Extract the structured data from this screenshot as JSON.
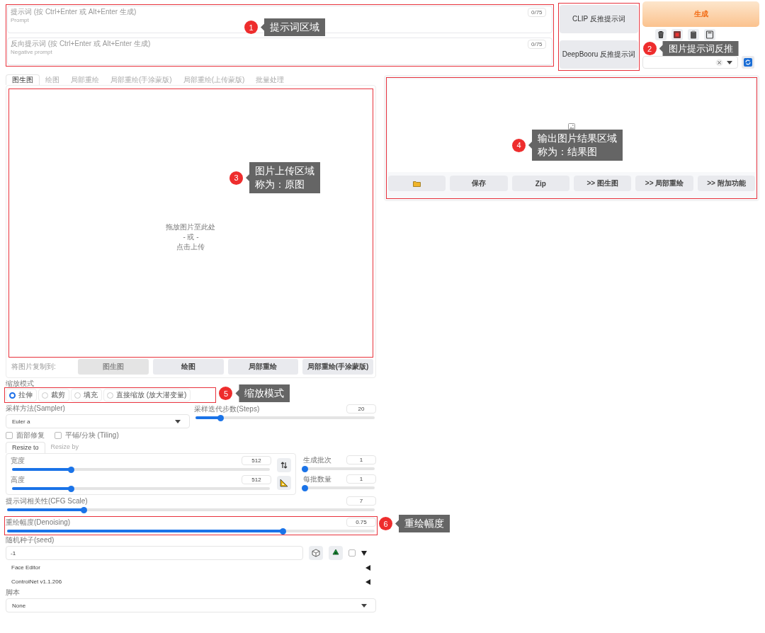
{
  "prompt": {
    "label": "提示词 (按 Ctrl+Enter 或 Alt+Enter 生成)",
    "placeholder": "Prompt",
    "counter": "0/75"
  },
  "negative_prompt": {
    "label": "反向提示词 (按 Ctrl+Enter 或 Alt+Enter 生成)",
    "placeholder": "Negative prompt",
    "counter": "0/75"
  },
  "interrogate_buttons": [
    {
      "label": "CLIP 反推提示词"
    },
    {
      "label": "DeepBooru 反推提示词"
    }
  ],
  "generate_button": "生成",
  "tabs": [
    {
      "label": "图生图",
      "selected": true
    },
    {
      "label": "绘图",
      "selected": false
    },
    {
      "label": "局部重绘",
      "selected": false
    },
    {
      "label": "局部重绘(手涂蒙版)",
      "selected": false
    },
    {
      "label": "局部重绘(上传蒙版)",
      "selected": false
    },
    {
      "label": "批量处理",
      "selected": false
    }
  ],
  "upload": {
    "lines": [
      "拖放图片至此处",
      "- 或 -",
      "点击上传"
    ]
  },
  "copy_to": {
    "label": "将图片复制到:",
    "buttons": [
      {
        "label": "图生图",
        "disabled": true
      },
      {
        "label": "绘图",
        "disabled": false
      },
      {
        "label": "局部重绘",
        "disabled": false
      },
      {
        "label": "局部重绘(手涂蒙版)",
        "disabled": false
      }
    ]
  },
  "resize_mode": {
    "label": "缩放模式",
    "options": [
      {
        "label": "拉伸",
        "selected": true
      },
      {
        "label": "裁剪",
        "selected": false
      },
      {
        "label": "填充",
        "selected": false
      },
      {
        "label": "直接缩放 (放大潜变量)",
        "selected": false
      }
    ]
  },
  "sampler": {
    "label": "采样方法(Sampler)",
    "value": "Euler a"
  },
  "steps": {
    "label": "采样迭代步数(Steps)",
    "value": "20",
    "level": 0.14
  },
  "checkboxes": [
    {
      "label": "面部修复",
      "checked": false
    },
    {
      "label": "平铺/分块 (Tiling)",
      "checked": false
    }
  ],
  "resize_tabs": [
    {
      "label": "Resize to",
      "selected": true
    },
    {
      "label": "Resize by",
      "selected": false
    }
  ],
  "width": {
    "label": "宽度",
    "value": "512",
    "level": 0.23
  },
  "height": {
    "label": "高度",
    "value": "512",
    "level": 0.23
  },
  "batch_count": {
    "label": "生成批次",
    "value": "1",
    "level": 0
  },
  "batch_size": {
    "label": "每批数量",
    "value": "1",
    "level": 0
  },
  "cfg_scale": {
    "label": "提示词相关性(CFG Scale)",
    "value": "7",
    "level": 0.21
  },
  "denoising": {
    "label": "重绘幅度(Denoising)",
    "value": "0.75",
    "level": 0.75
  },
  "seed": {
    "label": "随机种子(seed)",
    "value": "-1",
    "extra_checked": false
  },
  "accordions": [
    {
      "label": "Face Editor",
      "expanded": false
    },
    {
      "label": "ControlNet v1.1.206",
      "expanded": false
    }
  ],
  "script": {
    "label": "脚本",
    "value": "None"
  },
  "output_buttons": [
    {
      "kind": "folder"
    },
    {
      "kind": "text",
      "label": "保存"
    },
    {
      "kind": "text",
      "label": "Zip"
    },
    {
      "kind": "text",
      "label": ">> 图生图"
    },
    {
      "kind": "text",
      "label": ">> 局部重绘"
    },
    {
      "kind": "text",
      "label": ">> 附加功能"
    }
  ],
  "annotations": [
    {
      "number": "1",
      "lines": [
        "提示词区域"
      ]
    },
    {
      "number": "2",
      "lines": [
        "图片提示词反推"
      ]
    },
    {
      "number": "3",
      "lines": [
        "图片上传区域",
        "称为：原图"
      ]
    },
    {
      "number": "4",
      "lines": [
        "输出图片结果区域",
        "称为：结果图"
      ]
    },
    {
      "number": "5",
      "lines": [
        "缩放模式"
      ]
    },
    {
      "number": "6",
      "lines": [
        "重绘幅度"
      ]
    }
  ]
}
